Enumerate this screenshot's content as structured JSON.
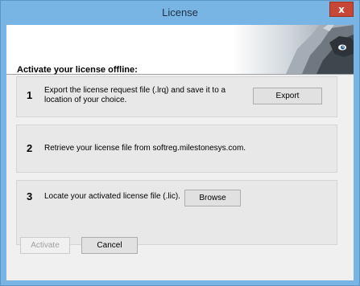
{
  "window": {
    "title": "License",
    "close_glyph": "x"
  },
  "banner": {
    "image": "wolf-logo-icon"
  },
  "section": {
    "title": "Activate your license offline:"
  },
  "steps": [
    {
      "number": "1",
      "text": "Export the license request file (.lrq) and save it to a location of your choice.",
      "button": "Export"
    },
    {
      "number": "2",
      "text": "Retrieve your license file from softreg.milestonesys.com."
    },
    {
      "number": "3",
      "text": "Locate your activated license file (.lic).",
      "button": "Browse"
    }
  ],
  "footer": {
    "activate_label": "Activate",
    "cancel_label": "Cancel",
    "activate_enabled": false
  },
  "colors": {
    "frame": "#78b4e4",
    "close": "#c74736",
    "client": "#f0f0f0",
    "panel": "#e8e8e8"
  }
}
